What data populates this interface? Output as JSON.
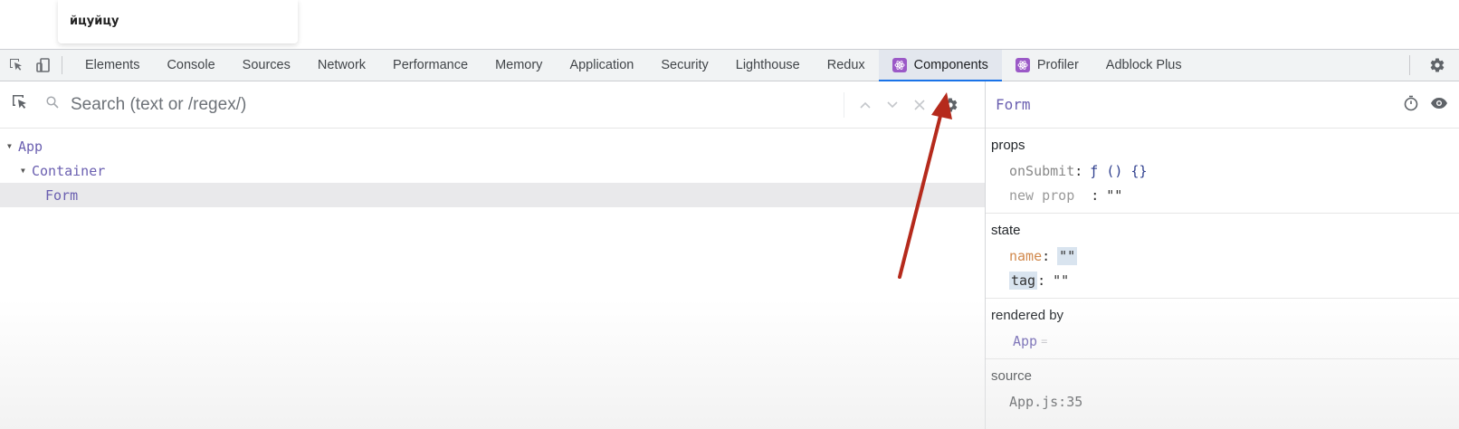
{
  "page": {
    "card_text": "йцуйцу"
  },
  "devtools": {
    "tabs": [
      {
        "label": "Elements",
        "icon": ""
      },
      {
        "label": "Console",
        "icon": ""
      },
      {
        "label": "Sources",
        "icon": ""
      },
      {
        "label": "Network",
        "icon": ""
      },
      {
        "label": "Performance",
        "icon": ""
      },
      {
        "label": "Memory",
        "icon": ""
      },
      {
        "label": "Application",
        "icon": ""
      },
      {
        "label": "Security",
        "icon": ""
      },
      {
        "label": "Lighthouse",
        "icon": ""
      },
      {
        "label": "Redux",
        "icon": ""
      },
      {
        "label": "Components",
        "icon": "react-icon",
        "active": true
      },
      {
        "label": "Profiler",
        "icon": "react-icon"
      },
      {
        "label": "Adblock Plus",
        "icon": ""
      }
    ],
    "accent_color": "#1a73e8"
  },
  "components": {
    "search": {
      "placeholder": "Search (text or /regex/)"
    },
    "tree": [
      {
        "label": "App",
        "depth": 0,
        "expanded": true
      },
      {
        "label": "Container",
        "depth": 1,
        "expanded": true
      },
      {
        "label": "Form",
        "depth": 2,
        "selected": true
      }
    ]
  },
  "inspector": {
    "title": "Form",
    "props_title": "props",
    "props": [
      {
        "key": "onSubmit",
        "value": "ƒ () {}"
      },
      {
        "key": "new prop",
        "value": "\"\""
      }
    ],
    "state_title": "state",
    "state": [
      {
        "key": "name",
        "value": "\"\""
      },
      {
        "key": "tag",
        "value": "\"\""
      }
    ],
    "rendered_by_title": "rendered by",
    "rendered_by": "App",
    "source_title": "source",
    "source": "App.js:35"
  },
  "colors": {
    "component_name": "#6a5fb0",
    "annotation_arrow": "#b52a1c"
  }
}
